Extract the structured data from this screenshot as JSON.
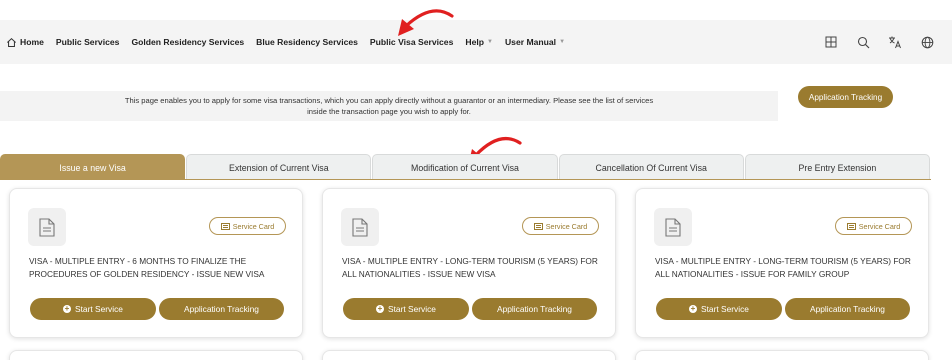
{
  "nav": {
    "items": [
      {
        "label": "Home",
        "icon": "home-icon"
      },
      {
        "label": "Public Services"
      },
      {
        "label": "Golden Residency Services"
      },
      {
        "label": "Blue Residency Services"
      },
      {
        "label": "Public Visa Services"
      },
      {
        "label": "Help",
        "dropdown": true
      },
      {
        "label": "User Manual",
        "dropdown": true
      }
    ],
    "right_icons": [
      "grid-icon",
      "search-icon",
      "translate-icon",
      "globe-icon"
    ]
  },
  "info": {
    "line1": "This page enables you to apply for some visa transactions, which you can apply directly without a guarantor or an intermediary. Please see the list of services",
    "line2": "inside the transaction page you wish to apply for.",
    "tracking_button": "Application Tracking"
  },
  "tabs": [
    {
      "label": "Issue a new Visa",
      "active": true
    },
    {
      "label": "Extension of Current Visa",
      "active": false
    },
    {
      "label": "Modification of Current Visa",
      "active": false
    },
    {
      "label": "Cancellation Of Current Visa",
      "active": false
    },
    {
      "label": "Pre Entry Extension",
      "active": false
    }
  ],
  "cards": [
    {
      "service_card": "Service Card",
      "title": "VISA - MULTIPLE ENTRY - 6 MONTHS TO FINALIZE THE PROCEDURES OF GOLDEN RESIDENCY - ISSUE NEW VISA",
      "start": "Start Service",
      "tracking": "Application Tracking"
    },
    {
      "service_card": "Service Card",
      "title": "VISA - MULTIPLE ENTRY - LONG-TERM TOURISM (5 YEARS) FOR ALL NATIONALITIES - ISSUE NEW VISA",
      "start": "Start Service",
      "tracking": "Application Tracking"
    },
    {
      "service_card": "Service Card",
      "title": "VISA - MULTIPLE ENTRY - LONG-TERM TOURISM (5 YEARS) FOR ALL NATIONALITIES - ISSUE FOR FAMILY GROUP",
      "start": "Start Service",
      "tracking": "Application Tracking"
    }
  ],
  "colors": {
    "accent": "#9a7b2f",
    "tab_active": "#b49656",
    "annotation_arrow": "#e02020"
  }
}
